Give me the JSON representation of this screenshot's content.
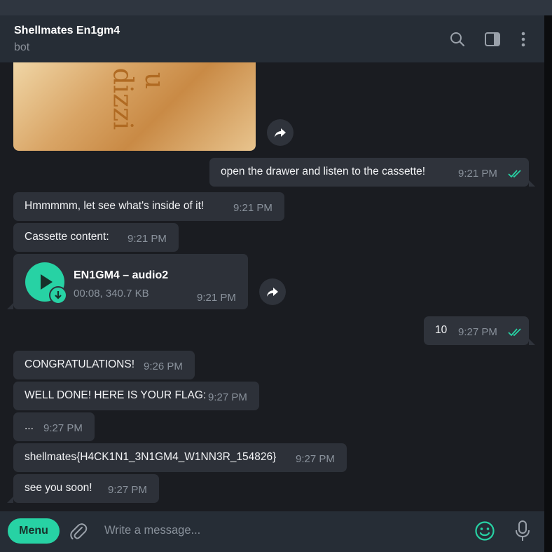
{
  "header": {
    "title": "Shellmates En1gm4",
    "subtitle": "bot",
    "icons": [
      "search-icon",
      "sidebar-toggle-icon",
      "more-vertical-icon"
    ]
  },
  "photo": {
    "text_a": "dizzi",
    "text_b": "u"
  },
  "messages": [
    {
      "text": "open the drawer and listen to the cassette!",
      "time": "9:21 PM",
      "out": true
    },
    {
      "text": "Hmmmmm, let see what's inside of it!",
      "time": "9:21 PM"
    },
    {
      "text": "Cassette content:",
      "time": "9:21 PM"
    },
    {
      "text": "10",
      "time": "9:27 PM",
      "out": true
    },
    {
      "text": "CONGRATULATIONS!",
      "time": "9:26 PM"
    },
    {
      "text": "WELL DONE! HERE IS YOUR FLAG:",
      "time": "9:27 PM"
    },
    {
      "text": "...",
      "time": "9:27 PM"
    },
    {
      "text": "shellmates{H4CK1N1_3N1GM4_W1NN3R_154826}",
      "time": "9:27 PM"
    },
    {
      "text": "see you soon!",
      "time": "9:27 PM"
    }
  ],
  "audio": {
    "title": "EN1GM4 – audio2",
    "meta": "00:08, 340.7 KB",
    "time": "9:21 PM"
  },
  "footer": {
    "menu_label": "Menu",
    "placeholder": "Write a message..."
  },
  "colors": {
    "accent": "#27d2a4",
    "bubble": "#2d3139",
    "background": "#1a1c21"
  }
}
